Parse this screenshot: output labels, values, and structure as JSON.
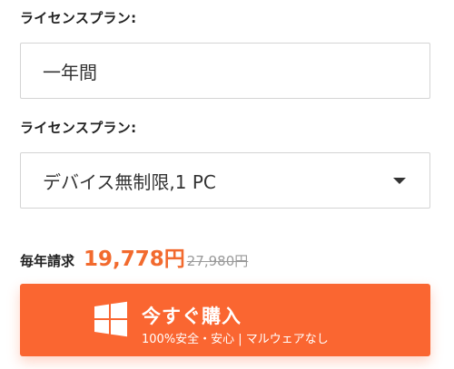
{
  "license_term": {
    "label": "ライセンスプラン:",
    "value": "一年間"
  },
  "license_plan": {
    "label": "ライセンスプラン:",
    "selected": "デバイス無制限,1 PC"
  },
  "pricing": {
    "billing_label": "毎年請求",
    "price": "19,778円",
    "original_price": "27,980円"
  },
  "buy_button": {
    "label": "今すぐ購入",
    "subtext": "100%安全・安心 | マルウェアなし",
    "icon": "windows-logo-icon"
  },
  "colors": {
    "accent": "#fa6631",
    "price": "#f26a2e",
    "strike": "#9a9a9a"
  }
}
